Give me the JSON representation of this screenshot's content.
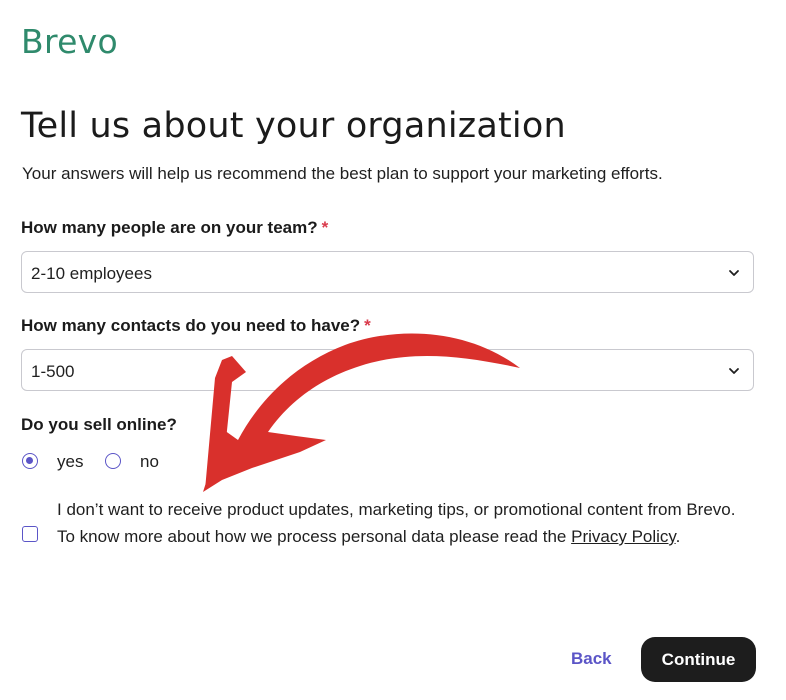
{
  "brand": {
    "logo_text": "Brevo",
    "color": "#2f8a6c"
  },
  "page": {
    "title": "Tell us about your organization",
    "subtitle": "Your answers will help us recommend the best plan to support your marketing efforts."
  },
  "team_size": {
    "label": "How many people are on your team?",
    "required_mark": "*",
    "selected": "2-10 employees",
    "icon": "chevron-down-icon"
  },
  "contacts": {
    "label": "How many contacts do you need to have?",
    "required_mark": "*",
    "selected": "1-500",
    "icon": "chevron-down-icon"
  },
  "sell_online": {
    "label": "Do you sell online?",
    "options": [
      {
        "label": "yes",
        "checked": true
      },
      {
        "label": "no",
        "checked": false
      }
    ]
  },
  "consent": {
    "checked": false,
    "text": "I don’t want to receive product updates, marketing tips, or promotional content from Brevo. To know more about how we process personal data please read the",
    "link_text": "Privacy Policy",
    "suffix": "."
  },
  "actions": {
    "back_label": "Back",
    "continue_label": "Continue"
  },
  "colors": {
    "accent": "#5b55c7",
    "required": "#d93a4b",
    "primary_button": "#1d1d1d",
    "annotation_arrow": "#d9302c"
  }
}
